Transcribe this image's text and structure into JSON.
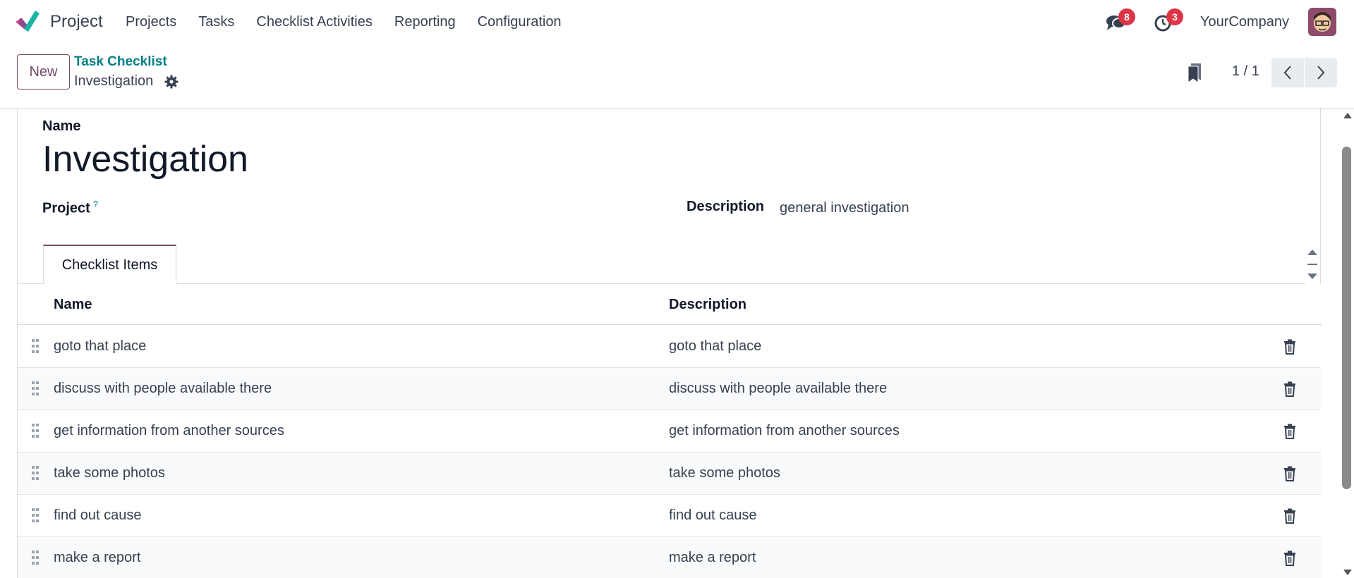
{
  "navbar": {
    "app_name": "Project",
    "menu": [
      "Projects",
      "Tasks",
      "Checklist Activities",
      "Reporting",
      "Configuration"
    ],
    "messages_badge": "8",
    "activities_badge": "3",
    "company": "YourCompany"
  },
  "control_panel": {
    "new_label": "New",
    "breadcrumb_parent": "Task Checklist",
    "breadcrumb_current": "Investigation",
    "pager": "1 / 1"
  },
  "form": {
    "name_label": "Name",
    "record_name": "Investigation",
    "project_label": "Project",
    "project_help": "?",
    "project_value": "",
    "description_label": "Description",
    "description_value": "general investigation"
  },
  "tabs": [
    {
      "label": "Checklist Items"
    }
  ],
  "list": {
    "columns": [
      "Name",
      "Description"
    ],
    "rows": [
      {
        "name": "goto that place",
        "description": "goto that place"
      },
      {
        "name": "discuss with people available there",
        "description": "discuss with people available there"
      },
      {
        "name": "get information from another sources",
        "description": "get information from another sources"
      },
      {
        "name": "take some photos",
        "description": "take some photos"
      },
      {
        "name": "find out cause",
        "description": "find out cause"
      },
      {
        "name": "make a report",
        "description": "make a report"
      }
    ]
  },
  "icons": {
    "messages": "chat-bubbles-icon",
    "activities": "clock-icon",
    "settings": "gear-icon",
    "bookmark": "bookmark-icon",
    "prev": "chevron-left-icon",
    "next": "chevron-right-icon",
    "drag": "drag-handle-icon",
    "delete": "trash-icon"
  },
  "colors": {
    "brand": "#714b67",
    "link": "#017e84",
    "badge": "#dc3545"
  }
}
